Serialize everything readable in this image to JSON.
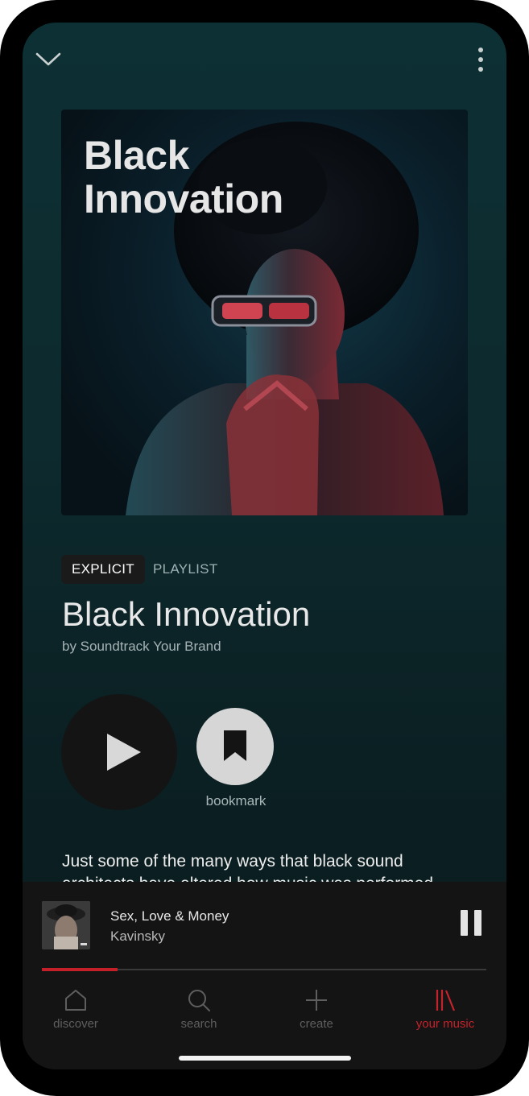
{
  "topbar": {
    "collapse_icon": "chevron-down-icon",
    "more_icon": "more-vertical-icon"
  },
  "cover": {
    "title_line1": "Black",
    "title_line2": "Innovation"
  },
  "playlist": {
    "badge": "EXPLICIT",
    "type": "PLAYLIST",
    "title": "Black Innovation",
    "owner": "by Soundtrack Your Brand",
    "description": "Just some of the many ways that black sound architects have altered how music was performed"
  },
  "actions": {
    "play_icon": "play-icon",
    "bookmark_icon": "bookmark-icon",
    "bookmark_label": "bookmark"
  },
  "now_playing": {
    "track": "Sex, Love & Money",
    "artist": "Kavinsky",
    "state_icon": "pause-icon",
    "progress": 0.17
  },
  "nav": [
    {
      "label": "discover",
      "icon": "home-icon",
      "active": false
    },
    {
      "label": "search",
      "icon": "search-icon",
      "active": false
    },
    {
      "label": "create",
      "icon": "plus-icon",
      "active": false
    },
    {
      "label": "your music",
      "icon": "library-icon",
      "active": true
    }
  ],
  "colors": {
    "accent": "#c4232c",
    "background": "#0d2a2e",
    "player": "#141414"
  }
}
